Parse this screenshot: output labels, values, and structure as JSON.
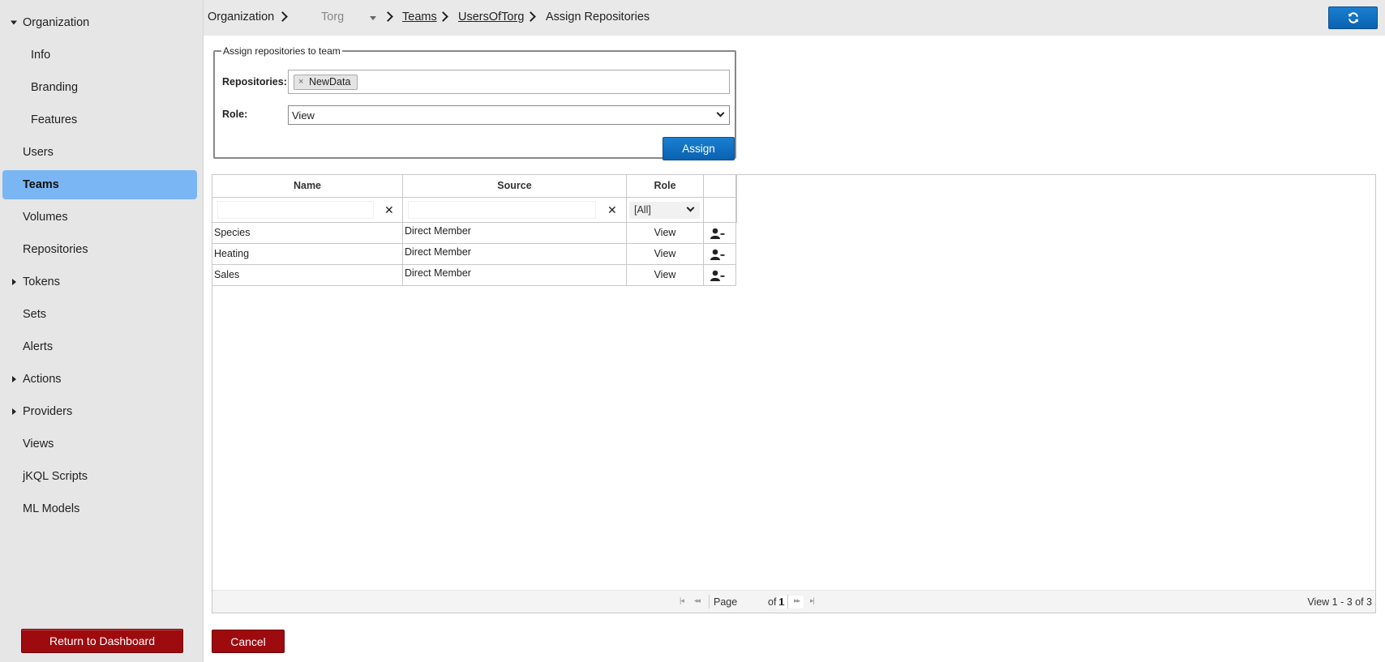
{
  "sidebar": {
    "items": [
      {
        "label": "Organization",
        "caret": "down"
      },
      {
        "label": "Info"
      },
      {
        "label": "Branding"
      },
      {
        "label": "Features"
      },
      {
        "label": "Users"
      },
      {
        "label": "Teams",
        "active": true
      },
      {
        "label": "Volumes"
      },
      {
        "label": "Repositories"
      },
      {
        "label": "Tokens",
        "caret": "right"
      },
      {
        "label": "Sets"
      },
      {
        "label": "Alerts"
      },
      {
        "label": "Actions",
        "caret": "right"
      },
      {
        "label": "Providers",
        "caret": "right"
      },
      {
        "label": "Views"
      },
      {
        "label": "jKQL Scripts"
      },
      {
        "label": "ML Models"
      }
    ],
    "return_label": "Return to Dashboard"
  },
  "breadcrumb": {
    "organization": "Organization",
    "org_select": "Torg",
    "teams": "Teams",
    "team": "UsersOfTorg",
    "current": "Assign Repositories"
  },
  "header": {
    "refresh_icon": "refresh-icon",
    "accent": "#0a62b0"
  },
  "assign_form": {
    "legend": "Assign repositories to team",
    "repositories_label": "Repositories:",
    "selected_repo": "NewData",
    "chip_remove": "×",
    "role_label": "Role:",
    "role_value": "View",
    "assign_label": "Assign"
  },
  "grid": {
    "columns": [
      "Name",
      "Source",
      "Role"
    ],
    "role_filter": "[All]",
    "clear_glyph": "✕",
    "rows": [
      {
        "name": "Species",
        "source": "Direct Member",
        "role": "View"
      },
      {
        "name": "Heating",
        "source": "Direct Member",
        "role": "View"
      },
      {
        "name": "Sales",
        "source": "Direct Member",
        "role": "View"
      }
    ],
    "pager": {
      "page_label": "Page",
      "page_value": "1",
      "of_label": "of 1",
      "view_text": "View 1 - 3 of 3"
    }
  },
  "cancel_label": "Cancel"
}
